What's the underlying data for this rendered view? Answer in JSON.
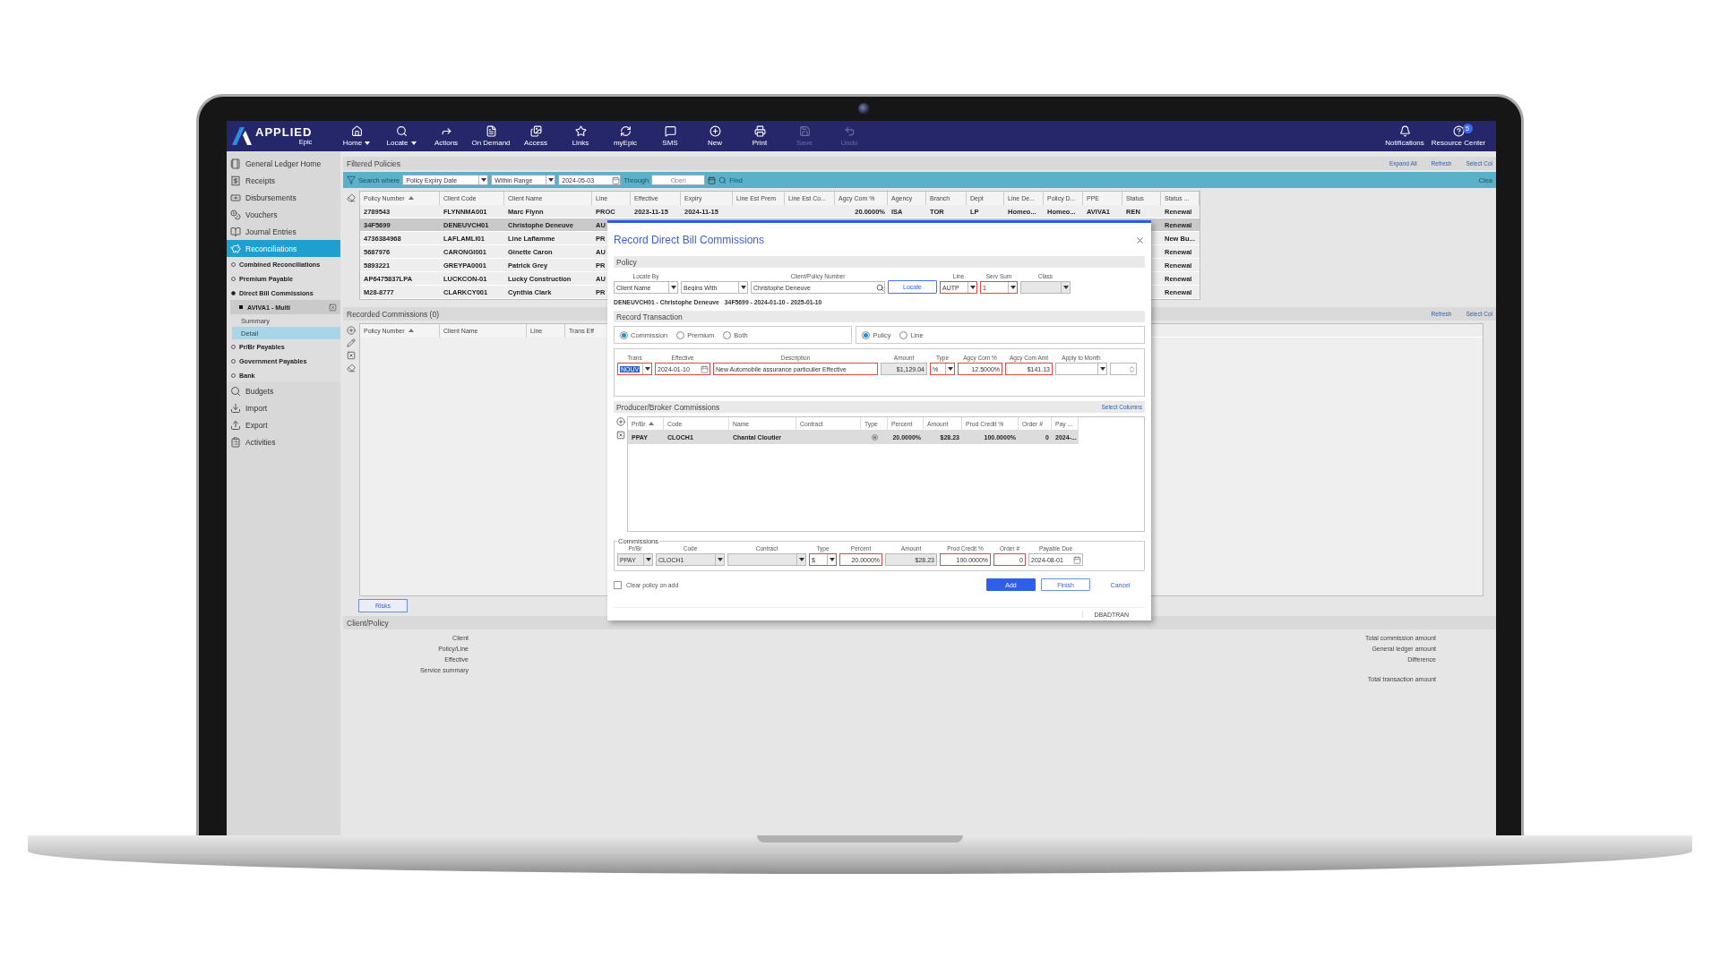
{
  "nav": {
    "logo": "APPLIED",
    "logo_sub": "Epic",
    "tools": [
      {
        "label": "Home",
        "menu": true,
        "disabled": false
      },
      {
        "label": "Locate",
        "menu": true,
        "disabled": false
      },
      {
        "label": "Actions",
        "menu": false,
        "disabled": false
      },
      {
        "label": "On Demand",
        "menu": false,
        "disabled": false
      },
      {
        "label": "Access",
        "menu": false,
        "disabled": false
      },
      {
        "label": "Links",
        "menu": false,
        "disabled": false
      },
      {
        "label": "myEpic",
        "menu": false,
        "disabled": false
      },
      {
        "label": "SMS",
        "menu": false,
        "disabled": false
      },
      {
        "label": "New",
        "menu": false,
        "disabled": false
      },
      {
        "label": "Print",
        "menu": false,
        "disabled": false
      },
      {
        "label": "Save",
        "menu": false,
        "disabled": true
      },
      {
        "label": "Undo",
        "menu": false,
        "disabled": true
      }
    ],
    "right": [
      {
        "label": "Notifications"
      },
      {
        "label": "Resource Center",
        "badge": "5"
      }
    ]
  },
  "sidebar": {
    "items": [
      {
        "label": "General Ledger Home",
        "selected": false
      },
      {
        "label": "Receipts",
        "selected": false
      },
      {
        "label": "Disbursements",
        "selected": false
      },
      {
        "label": "Vouchers",
        "selected": false
      },
      {
        "label": "Journal Entries",
        "selected": false
      },
      {
        "label": "Reconciliations",
        "selected": true,
        "children": [
          {
            "label": "Combined Reconciliations",
            "expanded": false
          },
          {
            "label": "Premium Payable",
            "expanded": false
          },
          {
            "label": "Direct Bill Commissions",
            "expanded": true,
            "children": [
              {
                "label": "AVIVA1 - Multi",
                "children": [
                  {
                    "label": "Summary",
                    "selected": false
                  },
                  {
                    "label": "Detail",
                    "selected": true
                  }
                ]
              }
            ]
          },
          {
            "label": "Pr/Br Payables",
            "expanded": false
          },
          {
            "label": "Government Payables",
            "expanded": false
          },
          {
            "label": "Bank",
            "expanded": false
          }
        ]
      },
      {
        "label": "Budgets",
        "selected": false
      },
      {
        "label": "Import",
        "selected": false
      },
      {
        "label": "Export",
        "selected": false
      },
      {
        "label": "Activities",
        "selected": false
      }
    ]
  },
  "filtered_policies": {
    "title": "Filtered Policies",
    "actions": [
      "Expand All",
      "Refresh",
      "Select Col"
    ],
    "filter": {
      "label": "Search where",
      "field": "Policy Expiry Date",
      "operator": "Within Range",
      "from": "2024-05-03",
      "through_label": "Through",
      "to_placeholder": "Open",
      "find": "Find",
      "clear": "Clea"
    },
    "columns": [
      {
        "label": "Policy Number",
        "sorted": true
      },
      {
        "label": "Client Code",
        "sorted": false
      },
      {
        "label": "Client Name",
        "sorted": false
      },
      {
        "label": "Line",
        "sorted": false
      },
      {
        "label": "Effective",
        "sorted": false
      },
      {
        "label": "Expiry",
        "sorted": false
      },
      {
        "label": "Line Est Prem",
        "sorted": false
      },
      {
        "label": "Line Est Co...",
        "sorted": false
      },
      {
        "label": "Agcy Com %",
        "sorted": false
      },
      {
        "label": "Agency",
        "sorted": false
      },
      {
        "label": "Branch",
        "sorted": false
      },
      {
        "label": "Dept",
        "sorted": false
      },
      {
        "label": "Line De...",
        "sorted": false
      },
      {
        "label": "Policy D...",
        "sorted": false
      },
      {
        "label": "PPE",
        "sorted": false
      },
      {
        "label": "Status",
        "sorted": false
      },
      {
        "label": "Status ...",
        "sorted": false
      }
    ],
    "rows": [
      {
        "selected": false,
        "cells": [
          "2789543",
          "FLYNNMA001",
          "Marc Flynn",
          "PROC",
          "2023-11-15",
          "2024-11-15",
          null,
          null,
          "20.0000%",
          "ISA",
          "TOR",
          "LP",
          "Homeo...",
          "Homeo...",
          "AVIVA1",
          "REN",
          "Renewal"
        ]
      },
      {
        "selected": true,
        "cells": [
          "34F5699",
          "DENEUVCH01",
          "Christophe Deneuve",
          "AU",
          null,
          null,
          null,
          null,
          null,
          null,
          null,
          null,
          null,
          null,
          null,
          null,
          "Renewal"
        ]
      },
      {
        "selected": false,
        "cells": [
          "4736384968",
          "LAFLAMLI01",
          "Line Laflamme",
          "PR",
          null,
          null,
          null,
          null,
          null,
          null,
          null,
          null,
          null,
          null,
          null,
          null,
          "New Bu..."
        ]
      },
      {
        "selected": false,
        "cells": [
          "5687976",
          "CARONGI001",
          "Ginette Caron",
          "AU",
          null,
          null,
          null,
          null,
          null,
          null,
          null,
          null,
          null,
          null,
          null,
          null,
          "Renewal"
        ]
      },
      {
        "selected": false,
        "cells": [
          "5893221",
          "GREYPA0001",
          "Patrick Grey",
          "PR",
          null,
          null,
          null,
          null,
          null,
          null,
          null,
          null,
          null,
          null,
          null,
          null,
          "Renewal"
        ]
      },
      {
        "selected": false,
        "cells": [
          "AP6475837LPA",
          "LUCKCON-01",
          "Lucky Construction",
          "AU",
          null,
          null,
          null,
          null,
          null,
          null,
          null,
          null,
          null,
          null,
          null,
          null,
          "Renewal"
        ]
      },
      {
        "selected": false,
        "cells": [
          "M28-8777",
          "CLARKCY001",
          "Cynthia Clark",
          "PR",
          null,
          null,
          null,
          null,
          null,
          null,
          null,
          null,
          null,
          null,
          null,
          null,
          "Renewal"
        ]
      }
    ]
  },
  "recorded_commissions": {
    "title": "Recorded Commissions (0)",
    "actions": [
      "Refresh",
      "Select Col"
    ],
    "columns": [
      {
        "label": "Policy Number",
        "sorted": true
      },
      {
        "label": "Client Name",
        "sorted": false
      },
      {
        "label": "Line",
        "sorted": false
      },
      {
        "label": "Trans Eff",
        "sorted": false
      }
    ],
    "risks_button": "Risks"
  },
  "client_policy": {
    "title": "Client/Policy",
    "left_labels": [
      "Client",
      "Policy/Line",
      "Effective",
      "Service summary"
    ],
    "right_labels": [
      "Total commission amount",
      "General ledger amount",
      "Difference",
      "Total transaction amount"
    ]
  },
  "dialog": {
    "title": "Record Direct Bill Commissions",
    "policy": {
      "title": "Policy",
      "fields": [
        {
          "kind": "select",
          "label": "Locate By",
          "value": "Client Name",
          "required": false,
          "disabled": false
        },
        {
          "kind": "select",
          "value": "Begins With",
          "required": false,
          "disabled": false
        },
        {
          "kind": "search",
          "label": "Client/Policy Number",
          "value": "Christophe Deneuve",
          "required": false,
          "disabled": false
        },
        {
          "kind": "button",
          "value": "Locate"
        },
        {
          "kind": "select",
          "label": "Line",
          "value": "AUTP",
          "required": true,
          "disabled": false
        },
        {
          "kind": "select",
          "label": "Serv Sum",
          "value": "1",
          "required": true,
          "disabled": false
        },
        {
          "kind": "select",
          "label": "Class",
          "required": false,
          "disabled": true
        }
      ],
      "summary": [
        "DENEUVCH01 - Christophe Deneuve",
        "34F5699 - 2024-01-10 - 2025-01-10"
      ]
    },
    "record_transaction": {
      "title": "Record Transaction",
      "transaction_types": [
        {
          "label": "Commission",
          "selected": true
        },
        {
          "label": "Premium",
          "selected": false
        },
        {
          "label": "Both",
          "selected": false
        }
      ],
      "apply_to": [
        {
          "label": "Policy",
          "selected": true
        },
        {
          "label": "Line",
          "selected": false
        }
      ],
      "fields": [
        {
          "kind": "select",
          "label": "Trans",
          "value": "NOUV",
          "required": true,
          "disabled": false,
          "highlighted": true
        },
        {
          "kind": "date",
          "label": "Effective",
          "value": "2024-01-10",
          "required": true,
          "disabled": false
        },
        {
          "kind": "text",
          "label": "Description",
          "value": "New Automobile assurance particulier Effective",
          "required": true,
          "disabled": false
        },
        {
          "kind": "number",
          "label": "Amount",
          "value": "$1,129.04",
          "required": false,
          "disabled": true
        },
        {
          "kind": "select",
          "label": "Type",
          "value": "%",
          "required": true,
          "disabled": false
        },
        {
          "kind": "number",
          "label": "Agcy Com %",
          "value": "12.5000%",
          "required": true,
          "disabled": false
        },
        {
          "kind": "number",
          "label": "Agcy Com Amt",
          "value": "$141.13",
          "required": true,
          "disabled": false
        },
        {
          "kind": "select",
          "label": "Apply to Month",
          "required": false,
          "disabled": false
        },
        {
          "kind": "spin",
          "required": false,
          "disabled": false
        }
      ]
    },
    "producer_broker": {
      "title": "Producer/Broker Commissions",
      "action": "Select Columns",
      "columns": [
        {
          "label": "Pr/Br",
          "sorted": true
        },
        {
          "label": "Code",
          "sorted": false
        },
        {
          "label": "Name",
          "sorted": false
        },
        {
          "label": "Contract",
          "sorted": false
        },
        {
          "label": "Type",
          "sorted": false,
          "kind": "icon"
        },
        {
          "label": "Percent",
          "sorted": false
        },
        {
          "label": "Amount",
          "sorted": false
        },
        {
          "label": "Prod Credit %",
          "sorted": false
        },
        {
          "label": "Order #",
          "sorted": false
        },
        {
          "label": "Pay ...",
          "sorted": false
        }
      ],
      "rows": [
        {
          "selected": true,
          "cells": [
            "PPAY",
            "CLOCH1",
            "Chantal Cloutier",
            null,
            null,
            "20.0000%",
            "$28.23",
            "100.0000%",
            "0",
            "2024-..."
          ]
        }
      ]
    },
    "commissions": {
      "title": "Commissions",
      "fields": [
        {
          "kind": "select",
          "label": "Pr/Br",
          "value": "PPAY",
          "required": false,
          "disabled": true
        },
        {
          "kind": "select",
          "label": "Code",
          "value": "CLOCH1",
          "required": false,
          "disabled": true
        },
        {
          "kind": "select",
          "label": "Contract",
          "required": false,
          "disabled": true
        },
        {
          "kind": "select",
          "label": "Type",
          "value": "$",
          "required": true,
          "disabled": false
        },
        {
          "kind": "number",
          "label": "Percent",
          "value": "20.0000%",
          "required": true,
          "disabled": false
        },
        {
          "kind": "number",
          "label": "Amount",
          "value": "$28.23",
          "required": false,
          "disabled": true
        },
        {
          "kind": "number",
          "label": "Prod Credit %",
          "value": "100.0000%",
          "required": true,
          "disabled": false
        },
        {
          "kind": "number",
          "label": "Order #",
          "value": "0",
          "required": true,
          "disabled": false
        },
        {
          "kind": "date",
          "label": "Payable Due",
          "value": "2024-08-01",
          "required": false,
          "disabled": false
        }
      ]
    },
    "clear_policy": {
      "label": "Clear policy on add",
      "checked": false
    },
    "buttons": [
      {
        "label": "Add",
        "kind": "primary"
      },
      {
        "label": "Finish",
        "kind": "secondary"
      },
      {
        "label": "Cancel",
        "kind": "link"
      }
    ],
    "status": "DBADTRAN"
  }
}
